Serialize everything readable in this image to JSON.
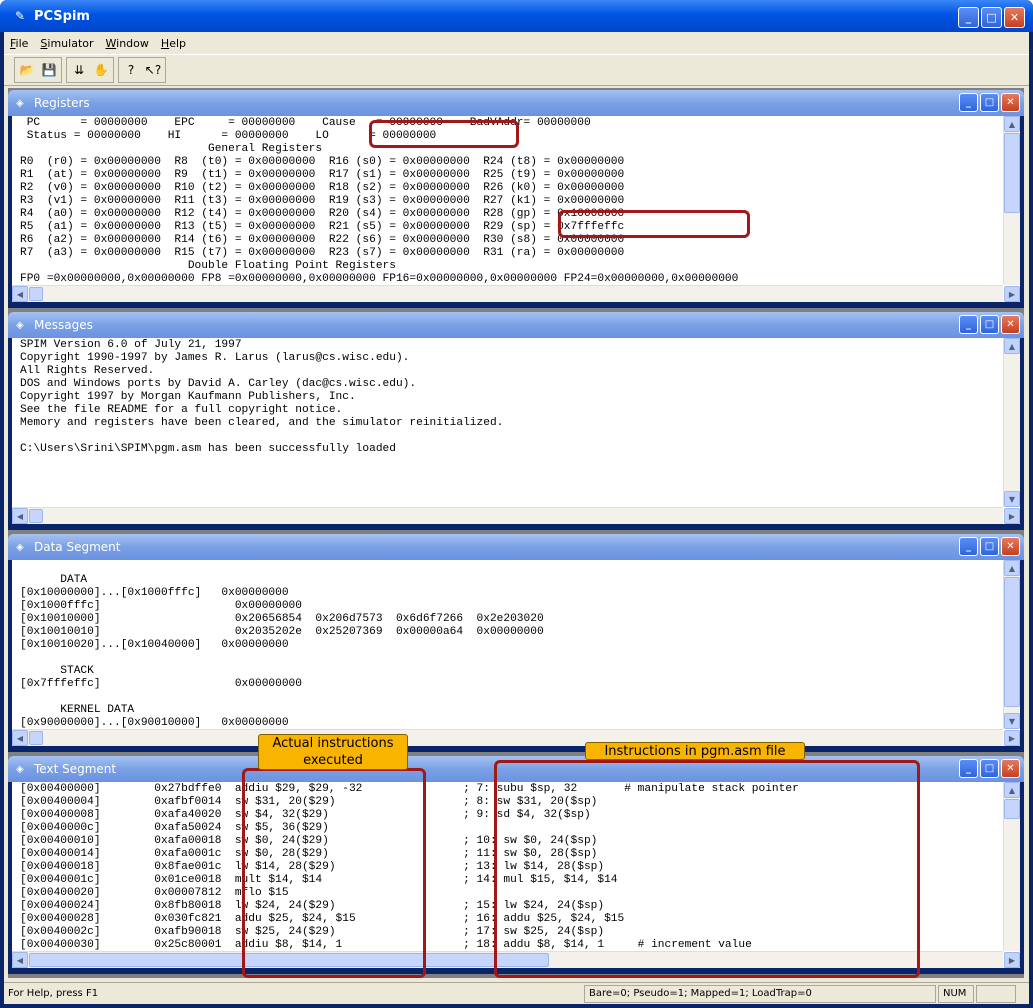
{
  "app": {
    "title": "PCSpim"
  },
  "menu": [
    "File",
    "Simulator",
    "Window",
    "Help"
  ],
  "windows": {
    "registers": {
      "title": "Registers",
      "text": " PC      = 00000000    EPC     = 00000000    Cause   = 00000000    BadVAddr= 00000000\n Status = 00000000    HI      = 00000000    LO      = 00000000\n                            General Registers\nR0  (r0) = 0x00000000  R8  (t0) = 0x00000000  R16 (s0) = 0x00000000  R24 (t8) = 0x00000000\nR1  (at) = 0x00000000  R9  (t1) = 0x00000000  R17 (s1) = 0x00000000  R25 (t9) = 0x00000000\nR2  (v0) = 0x00000000  R10 (t2) = 0x00000000  R18 (s2) = 0x00000000  R26 (k0) = 0x00000000\nR3  (v1) = 0x00000000  R11 (t3) = 0x00000000  R19 (s3) = 0x00000000  R27 (k1) = 0x00000000\nR4  (a0) = 0x00000000  R12 (t4) = 0x00000000  R20 (s4) = 0x00000000  R28 (gp) = 0x10008000\nR5  (a1) = 0x00000000  R13 (t5) = 0x00000000  R21 (s5) = 0x00000000  R29 (sp) = 0x7fffeffc\nR6  (a2) = 0x00000000  R14 (t6) = 0x00000000  R22 (s6) = 0x00000000  R30 (s8) = 0x00000000\nR7  (a3) = 0x00000000  R15 (t7) = 0x00000000  R23 (s7) = 0x00000000  R31 (ra) = 0x00000000\n                         Double Floating Point Registers\nFP0 =0x00000000,0x00000000 FP8 =0x00000000,0x00000000 FP16=0x00000000,0x00000000 FP24=0x00000000,0x00000000"
    },
    "messages": {
      "title": "Messages",
      "text": "SPIM Version 6.0 of July 21, 1997\nCopyright 1990-1997 by James R. Larus (larus@cs.wisc.edu).\nAll Rights Reserved.\nDOS and Windows ports by David A. Carley (dac@cs.wisc.edu).\nCopyright 1997 by Morgan Kaufmann Publishers, Inc.\nSee the file README for a full copyright notice.\nMemory and registers have been cleared, and the simulator reinitialized.\n\nC:\\Users\\Srini\\SPIM\\pgm.asm has been successfully loaded"
    },
    "data": {
      "title": "Data Segment",
      "text": "\n      DATA\n[0x10000000]...[0x1000fffc]   0x00000000\n[0x1000fffc]                    0x00000000\n[0x10010000]                    0x20656854  0x206d7573  0x6d6f7266  0x2e203020\n[0x10010010]                    0x2035202e  0x25207369  0x00000a64  0x00000000\n[0x10010020]...[0x10040000]   0x00000000\n\n      STACK\n[0x7fffeffc]                    0x00000000\n\n      KERNEL DATA\n[0x90000000]...[0x90010000]   0x00000000"
    },
    "text": {
      "title": "Text Segment",
      "text": "[0x00400000]        0x27bdffe0  addiu $29, $29, -32               ; 7: subu $sp, 32       # manipulate stack pointer\n[0x00400004]        0xafbf0014  sw $31, 20($29)                   ; 8: sw $31, 20($sp)\n[0x00400008]        0xafa40020  sw $4, 32($29)                    ; 9: sd $4, 32($sp)\n[0x0040000c]        0xafa50024  sw $5, 36($29)\n[0x00400010]        0xafa00018  sw $0, 24($29)                    ; 10: sw $0, 24($sp)\n[0x00400014]        0xafa0001c  sw $0, 28($29)                    ; 11: sw $0, 28($sp)\n[0x00400018]        0x8fae001c  lw $14, 28($29)                   ; 13: lw $14, 28($sp)\n[0x0040001c]        0x01ce0018  mult $14, $14                     ; 14: mul $15, $14, $14\n[0x00400020]        0x00007812  mflo $15\n[0x00400024]        0x8fb80018  lw $24, 24($29)                   ; 15: lw $24, 24($sp)\n[0x00400028]        0x030fc821  addu $25, $24, $15                ; 16: addu $25, $24, $15\n[0x0040002c]        0xafb90018  sw $25, 24($29)                   ; 17: sw $25, 24($sp)\n[0x00400030]        0x25c80001  addiu $8, $14, 1                  ; 18: addu $8, $14, 1     # increment value"
    }
  },
  "annotations": {
    "actual": "Actual instructions executed",
    "pgm": "Instructions in pgm.asm file"
  },
  "status": {
    "help": "For Help, press F1",
    "flags": "Bare=0; Pseudo=1; Mapped=1; LoadTrap=0",
    "num": "NUM"
  }
}
